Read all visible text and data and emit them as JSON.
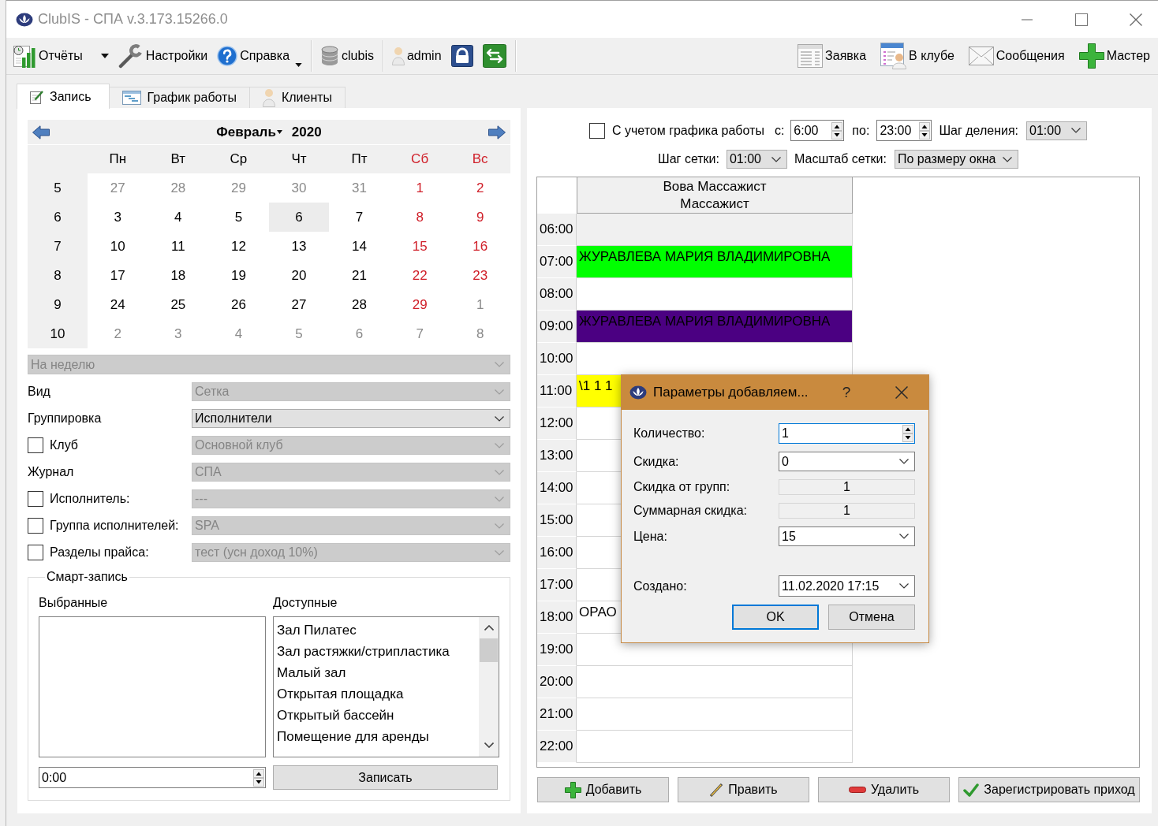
{
  "window": {
    "title": "ClubIS - СПА v.3.173.15266.0"
  },
  "toolbar": {
    "groups": [
      [
        {
          "label": "Отчёты",
          "kind": "split"
        },
        {
          "label": "Настройки",
          "kind": "plain"
        },
        {
          "label": "Справка",
          "kind": "menu"
        }
      ],
      [
        {
          "label": "clubis",
          "kind": "plain"
        }
      ],
      [
        {
          "label": "admin",
          "kind": "plain"
        }
      ]
    ],
    "right": [
      "Заявка",
      "В клубе",
      "Сообщения",
      "Мастер"
    ]
  },
  "tabs": [
    {
      "label": "Запись",
      "selected": true
    },
    {
      "label": "График работы",
      "selected": false
    },
    {
      "label": "Клиенты",
      "selected": false
    }
  ],
  "calendar": {
    "month": "Февраль",
    "year": "2020",
    "weekdays": [
      {
        "label": "Пн",
        "weekend": false
      },
      {
        "label": "Вт",
        "weekend": false
      },
      {
        "label": "Ср",
        "weekend": false
      },
      {
        "label": "Чт",
        "weekend": false
      },
      {
        "label": "Пт",
        "weekend": false
      },
      {
        "label": "Сб",
        "weekend": true
      },
      {
        "label": "Вс",
        "weekend": true
      }
    ],
    "weeks": [
      {
        "number": "5",
        "days": [
          {
            "day": "27",
            "outside_month": true,
            "selected": false
          },
          {
            "day": "28",
            "outside_month": true,
            "selected": false
          },
          {
            "day": "29",
            "outside_month": true,
            "selected": false
          },
          {
            "day": "30",
            "outside_month": true,
            "selected": false
          },
          {
            "day": "31",
            "outside_month": true,
            "selected": false
          },
          {
            "day": "1",
            "outside_month": false,
            "selected": false
          },
          {
            "day": "2",
            "outside_month": false,
            "selected": false
          }
        ]
      },
      {
        "number": "6",
        "days": [
          {
            "day": "3",
            "outside_month": false,
            "selected": false
          },
          {
            "day": "4",
            "outside_month": false,
            "selected": false
          },
          {
            "day": "5",
            "outside_month": false,
            "selected": false
          },
          {
            "day": "6",
            "outside_month": false,
            "selected": true
          },
          {
            "day": "7",
            "outside_month": false,
            "selected": false
          },
          {
            "day": "8",
            "outside_month": false,
            "selected": false
          },
          {
            "day": "9",
            "outside_month": false,
            "selected": false
          }
        ]
      },
      {
        "number": "7",
        "days": [
          {
            "day": "10",
            "outside_month": false,
            "selected": false
          },
          {
            "day": "11",
            "outside_month": false,
            "selected": false
          },
          {
            "day": "12",
            "outside_month": false,
            "selected": false
          },
          {
            "day": "13",
            "outside_month": false,
            "selected": false
          },
          {
            "day": "14",
            "outside_month": false,
            "selected": false
          },
          {
            "day": "15",
            "outside_month": false,
            "selected": false
          },
          {
            "day": "16",
            "outside_month": false,
            "selected": false
          }
        ]
      },
      {
        "number": "8",
        "days": [
          {
            "day": "17",
            "outside_month": false,
            "selected": false
          },
          {
            "day": "18",
            "outside_month": false,
            "selected": false
          },
          {
            "day": "19",
            "outside_month": false,
            "selected": false
          },
          {
            "day": "20",
            "outside_month": false,
            "selected": false
          },
          {
            "day": "21",
            "outside_month": false,
            "selected": false
          },
          {
            "day": "22",
            "outside_month": false,
            "selected": false
          },
          {
            "day": "23",
            "outside_month": false,
            "selected": false
          }
        ]
      },
      {
        "number": "9",
        "days": [
          {
            "day": "24",
            "outside_month": false,
            "selected": false
          },
          {
            "day": "25",
            "outside_month": false,
            "selected": false
          },
          {
            "day": "26",
            "outside_month": false,
            "selected": false
          },
          {
            "day": "27",
            "outside_month": false,
            "selected": false
          },
          {
            "day": "28",
            "outside_month": false,
            "selected": false
          },
          {
            "day": "29",
            "outside_month": false,
            "selected": false
          },
          {
            "day": "1",
            "outside_month": true,
            "selected": false
          }
        ]
      },
      {
        "number": "10",
        "days": [
          {
            "day": "2",
            "outside_month": true,
            "selected": false
          },
          {
            "day": "3",
            "outside_month": true,
            "selected": false
          },
          {
            "day": "4",
            "outside_month": true,
            "selected": false
          },
          {
            "day": "5",
            "outside_month": true,
            "selected": false
          },
          {
            "day": "6",
            "outside_month": true,
            "selected": false
          },
          {
            "day": "7",
            "outside_month": true,
            "selected": false
          },
          {
            "day": "8",
            "outside_month": true,
            "selected": false
          }
        ]
      }
    ]
  },
  "filters": {
    "period": {
      "value": "На неделю",
      "disabled": true
    },
    "rows": [
      {
        "kind": "plain",
        "label": "Вид",
        "value": "Сетка",
        "disabled": true
      },
      {
        "kind": "plain",
        "label": "Группировка",
        "value": "Исполнители",
        "disabled": false
      },
      {
        "kind": "checkbox",
        "label": "Клуб",
        "checked": false,
        "value": "Основной клуб",
        "disabled": true
      },
      {
        "kind": "plain",
        "label": "Журнал",
        "value": "СПА",
        "disabled": true
      },
      {
        "kind": "checkbox",
        "label": "Исполнитель:",
        "checked": false,
        "value": "---",
        "disabled": true
      },
      {
        "kind": "checkbox",
        "label": "Группа исполнителей:",
        "checked": false,
        "value": "SPA",
        "disabled": true
      },
      {
        "kind": "checkbox",
        "label": "Разделы прайса:",
        "checked": false,
        "value": "тест (усн доход 10%)",
        "disabled": true
      }
    ]
  },
  "smart_record": {
    "title": "Смарт-запись",
    "selected_label": "Выбранные",
    "available_label": "Доступные",
    "available": [
      {
        "label": "Зал Пилатес",
        "selected": false
      },
      {
        "label": "Зал растяжки/стрипластика",
        "selected": false
      },
      {
        "label": "Малый зал",
        "selected": false
      },
      {
        "label": "Открытая площадка",
        "selected": false
      },
      {
        "label": "Открытый бассейн",
        "selected": false
      },
      {
        "label": "Помещение для аренды",
        "selected": false
      }
    ],
    "duration": "0:00",
    "submit": "Записать"
  },
  "schedule_options": {
    "use_schedule": {
      "label": "С учетом графика работы",
      "checked": false
    },
    "from_label": "с:",
    "from": "6:00",
    "to_label": "по:",
    "to": "23:00",
    "division_label": "Шаг деления:",
    "division": "01:00",
    "grid_step_label": "Шаг сетки:",
    "grid_step": "01:00",
    "scale_label": "Масштаб сетки:",
    "scale": "По размеру окна"
  },
  "schedule": {
    "performer": {
      "name": "Вова Массажист",
      "role": "Массажист"
    },
    "rows": [
      {
        "time": "06:00",
        "kind": "closed"
      },
      {
        "time": "07:00",
        "kind": "booking",
        "text": "ЖУРАВЛЕВА МАРИЯ ВЛАДИМИРОВНА",
        "color": "#00ff00"
      },
      {
        "time": "08:00",
        "kind": "free"
      },
      {
        "time": "09:00",
        "kind": "booking",
        "text": "ЖУРАВЛЕВА МАРИЯ ВЛАДИМИРОВНА",
        "color": "#4b0082"
      },
      {
        "time": "10:00",
        "kind": "free"
      },
      {
        "time": "11:00",
        "kind": "booking",
        "text": "\\1 1 1",
        "color": "#ffff00"
      },
      {
        "time": "12:00",
        "kind": "free"
      },
      {
        "time": "13:00",
        "kind": "free"
      },
      {
        "time": "14:00",
        "kind": "free"
      },
      {
        "time": "15:00",
        "kind": "free"
      },
      {
        "time": "16:00",
        "kind": "free"
      },
      {
        "time": "17:00",
        "kind": "free"
      },
      {
        "time": "18:00",
        "kind": "booking",
        "text": "ОРАО",
        "color": "#ffffff"
      },
      {
        "time": "19:00",
        "kind": "free"
      },
      {
        "time": "20:00",
        "kind": "free"
      },
      {
        "time": "21:00",
        "kind": "free"
      },
      {
        "time": "22:00",
        "kind": "free"
      }
    ]
  },
  "actions": [
    "Добавить",
    "Править",
    "Удалить",
    "Зарегистрировать приход"
  ],
  "dialog": {
    "title": "Параметры добавляем...",
    "help": "?",
    "fields": [
      {
        "label": "Количество:",
        "kind": "spin",
        "value": "1",
        "focused": true
      },
      {
        "label": "Скидка:",
        "kind": "combo",
        "value": "0",
        "focused": false
      },
      {
        "label": "Скидка от групп:",
        "kind": "readonly",
        "value": "1",
        "focused": false
      },
      {
        "label": "Суммарная скидка:",
        "kind": "readonly",
        "value": "1",
        "focused": false
      },
      {
        "label": "Цена:",
        "kind": "combo",
        "value": "15",
        "focused": false
      },
      {
        "label": "Создано:",
        "kind": "combo",
        "value": "11.02.2020 17:15",
        "focused": false
      }
    ],
    "buttons": [
      {
        "label": "OK",
        "default": true
      },
      {
        "label": "Отмена",
        "default": false
      }
    ]
  }
}
